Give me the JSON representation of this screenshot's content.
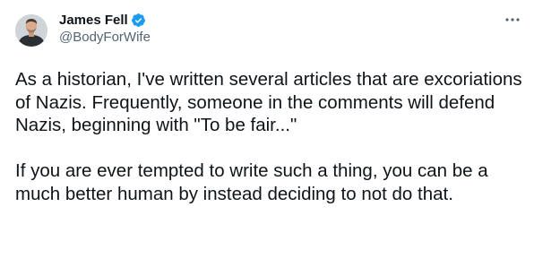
{
  "author": {
    "display_name": "James Fell",
    "handle": "@BodyForWife",
    "verified": true
  },
  "icons": {
    "verified": "verified-badge-icon",
    "more": "more-horizontal-icon"
  },
  "colors": {
    "verified_blue": "#1d9bf0",
    "handle_gray": "#536471",
    "text": "#0f1419"
  },
  "tweet": {
    "paragraphs": [
      "As a historian, I've written several articles that are excoriations of Nazis. Frequently, someone in the comments will defend Nazis, beginning with \"To be fair...\"",
      "If you are ever tempted to write such a thing, you can be a much better human by instead deciding to not do that."
    ]
  }
}
